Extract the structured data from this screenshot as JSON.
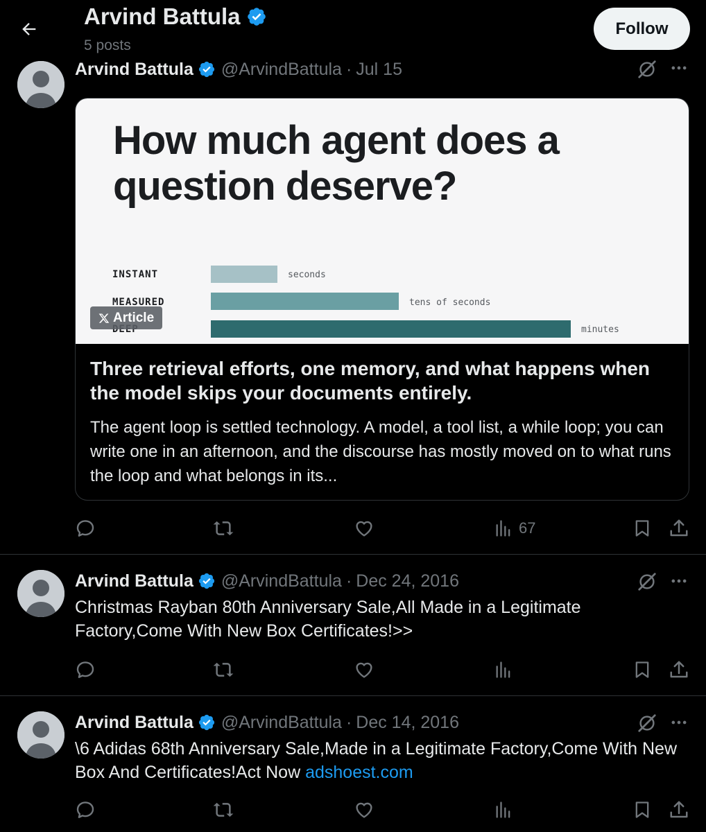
{
  "header": {
    "name": "Arvind Battula",
    "posts_count": "5 posts",
    "follow_label": "Follow"
  },
  "colors": {
    "background": "#000000",
    "text": "#e7e9ea",
    "muted": "#71767b",
    "link": "#1d9bf0",
    "verified": "#1d9bf0",
    "bar_instant": "#a6c1c6",
    "bar_measured": "#6a9fa3",
    "bar_deep": "#2e6b6e"
  },
  "icons": {
    "back": "arrow-left-icon",
    "verified": "verified-badge-icon",
    "grok": "grok-icon",
    "more": "more-icon",
    "reply": "reply-icon",
    "repost": "repost-icon",
    "like": "like-icon",
    "views": "views-icon",
    "bookmark": "bookmark-icon",
    "share": "share-icon"
  },
  "posts": [
    {
      "author": "Arvind Battula",
      "handle": "@ArvindBattula",
      "separator": "·",
      "date": "Jul 15",
      "article": {
        "image_headline": "How much agent does a question deserve?",
        "chart_rows": [
          {
            "label": "INSTANT",
            "value": "seconds",
            "relative_length": 0.185
          },
          {
            "label": "MEASURED",
            "value": "tens of seconds",
            "relative_length": 0.52
          },
          {
            "label": "DEEP",
            "value": "minutes",
            "relative_length": 1.0
          }
        ],
        "badge": "Article",
        "title": "Three retrieval efforts, one memory, and what happens when the model skips your documents entirely.",
        "description": "The agent loop is settled technology. A model, a tool list, a while loop; you can write one in an afternoon, and the discourse has mostly moved on to what runs the loop and what belongs in its..."
      },
      "views": "67"
    },
    {
      "author": "Arvind Battula",
      "handle": "@ArvindBattula",
      "separator": "·",
      "date": "Dec 24, 2016",
      "text": "Christmas Rayban 80th Anniversary Sale,All Made in a Legitimate Factory,Come With New Box Certificates!>>"
    },
    {
      "author": "Arvind Battula",
      "handle": "@ArvindBattula",
      "separator": "·",
      "date": "Dec 14, 2016",
      "text": "\\6 Adidas 68th Anniversary Sale,Made in a Legitimate Factory,Come With New Box And Certificates!Act Now ",
      "link": "adshoest.com"
    }
  ]
}
